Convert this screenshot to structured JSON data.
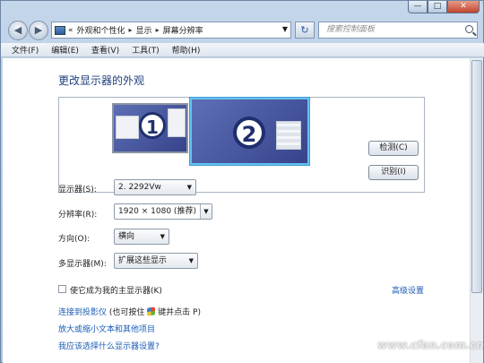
{
  "window": {
    "controls": {
      "minimize": "—",
      "maximize": "□",
      "close": "✕"
    }
  },
  "navigation": {
    "back": "◀",
    "forward": "▶",
    "address": {
      "overflow": "«",
      "segments": [
        "外观和个性化",
        "显示",
        "屏幕分辨率"
      ],
      "separator": "▸"
    },
    "refresh_symbol": "↻",
    "search_placeholder": "搜索控制面板"
  },
  "menu": [
    "文件(F)",
    "编辑(E)",
    "查看(V)",
    "工具(T)",
    "帮助(H)"
  ],
  "main": {
    "heading": "更改显示器的外观",
    "monitors": [
      {
        "number": "1"
      },
      {
        "number": "2",
        "selected": true
      }
    ],
    "detect_button": "检测(C)",
    "identify_button": "识别(I)",
    "display": {
      "label": "显示器(S):",
      "value": "2. 2292Vw"
    },
    "resolution": {
      "label": "分辨率(R):",
      "value": "1920 × 1080 (推荐)"
    },
    "orientation": {
      "label": "方向(O):",
      "value": "横向"
    },
    "multiple_displays": {
      "label": "多显示器(M):",
      "value": "扩展这些显示"
    },
    "make_main": {
      "label": "使它成为我的主显示器(K)",
      "checked": false
    },
    "advanced_settings": "高级设置",
    "links": {
      "projector": "连接到投影仪",
      "projector_hint_prefix": "(也可按住",
      "projector_hint_suffix": "键并点击 P)",
      "larger_text": "放大或缩小文本和其他项目",
      "which_settings": "我应该选择什么显示器设置?"
    }
  },
  "watermark": "www.cfan.com.cn",
  "colors": {
    "link": "#1a5bb6",
    "heading": "#1e3f7a",
    "selected_monitor_border": "#66c1f0"
  }
}
